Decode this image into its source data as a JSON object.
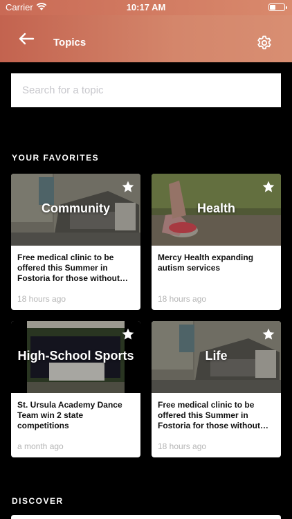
{
  "status_bar": {
    "carrier": "Carrier",
    "time": "10:17 AM"
  },
  "nav": {
    "title": "Topics"
  },
  "search": {
    "placeholder": "Search for a topic"
  },
  "sections": {
    "favorites": "YOUR FAVORITES",
    "discover": "DISCOVER"
  },
  "favorites": [
    {
      "topic": "Community",
      "headline": "Free medical clinic to be offered this Summer in Fostoria for those without in...",
      "ago": "18 hours ago",
      "image": "waiting-room-chairs"
    },
    {
      "topic": "Health",
      "headline": "Mercy Health expanding autism services",
      "ago": "18 hours ago",
      "image": "running-shoes"
    },
    {
      "topic": "High-School Sports",
      "headline": "St. Ursula Academy Dance Team win 2 state competitions",
      "ago": "a month ago",
      "image": "dance-team-photo"
    },
    {
      "topic": "Life",
      "headline": "Free medical clinic to be offered this Summer in Fostoria for those without in...",
      "ago": "18 hours ago",
      "image": "waiting-room-chairs"
    }
  ],
  "colors": {
    "nav_gradient_start": "#c3634f",
    "nav_gradient_end": "#d88e72",
    "background": "#000000",
    "card": "#ffffff",
    "timestamp": "#b5b5b5"
  }
}
